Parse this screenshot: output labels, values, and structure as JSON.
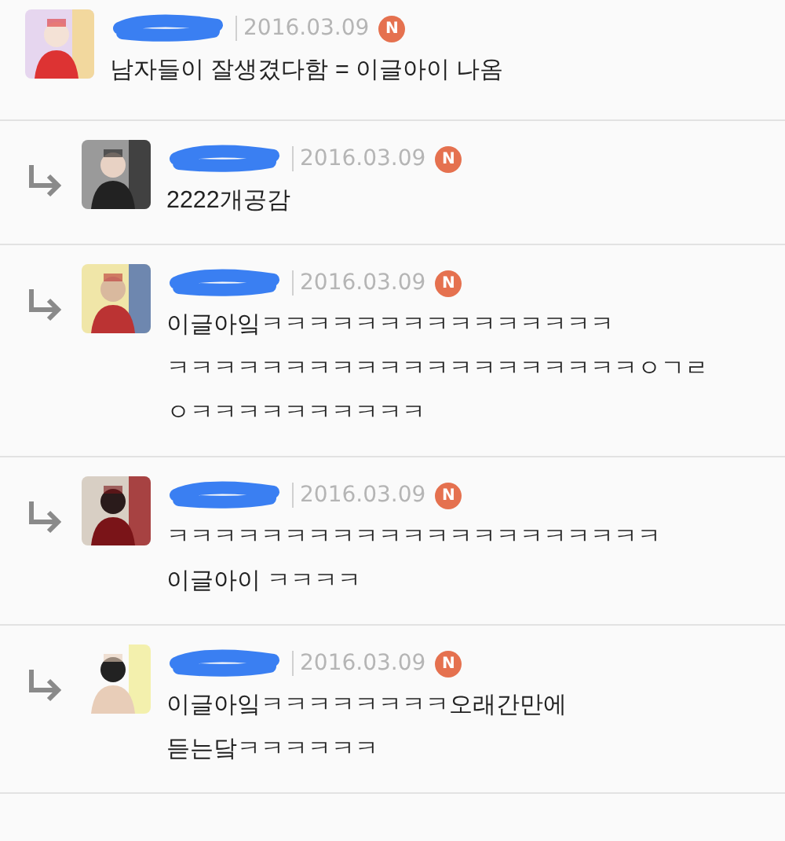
{
  "comments": [
    {
      "kind": "comment",
      "author_redacted": true,
      "date": "2016.03.09",
      "badge": "N",
      "lines": [
        "남자들이 잘생겼다함 = 이글아이 나옴"
      ]
    },
    {
      "kind": "reply",
      "author_redacted": true,
      "date": "2016.03.09",
      "badge": "N",
      "lines": [
        "2222개공감"
      ]
    },
    {
      "kind": "reply",
      "author_redacted": true,
      "date": "2016.03.09",
      "badge": "N",
      "lines": [
        "이글아잌ㅋㅋㅋㅋㅋㅋㅋㅋㅋㅋㅋㅋㅋㅋㅋ",
        "ㅋㅋㅋㅋㅋㅋㅋㅋㅋㅋㅋㅋㅋㅋㅋㅋㅋㅋㅋㅋㅇㄱㄹ",
        "ㅇㅋㅋㅋㅋㅋㅋㅋㅋㅋㅋ"
      ]
    },
    {
      "kind": "reply",
      "author_redacted": true,
      "date": "2016.03.09",
      "badge": "N",
      "lines": [
        "ㅋㅋㅋㅋㅋㅋㅋㅋㅋㅋㅋㅋㅋㅋㅋㅋㅋㅋㅋㅋㅋ",
        "이글아이 ㅋㅋㅋㅋ"
      ]
    },
    {
      "kind": "reply",
      "author_redacted": true,
      "date": "2016.03.09",
      "badge": "N",
      "lines": [
        "이글아잌ㅋㅋㅋㅋㅋㅋㅋㅋ오래간만에",
        "듣는닼ㅋㅋㅋㅋㅋㅋ"
      ]
    }
  ]
}
